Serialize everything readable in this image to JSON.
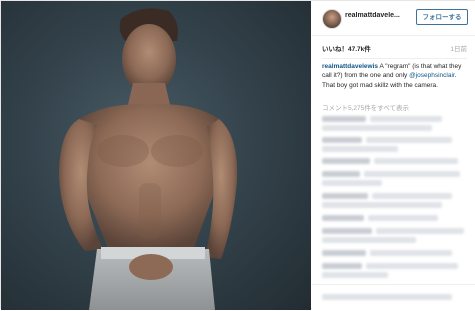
{
  "header": {
    "username": "realmattdavele...",
    "follow_label": "フォローする"
  },
  "stats": {
    "likes": "いいね！47.7k件",
    "age": "1日前"
  },
  "caption": {
    "user": "realmattdavelewis",
    "text_before": " A \"regram\" (is that what they call it?) from the one and only ",
    "mention": "@josephsinclair",
    "text_after": ". That boy got mad skillz with the camera."
  },
  "comments": {
    "more_label": "コメント5,275件をすべて表示"
  },
  "colors": {
    "link": "#125688",
    "follow": "#3f729b",
    "muted": "#a5a7aa"
  }
}
